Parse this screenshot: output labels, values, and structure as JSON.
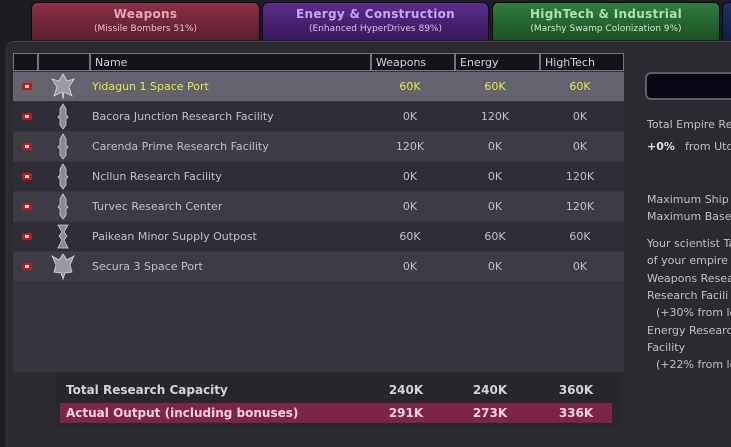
{
  "tabs": [
    {
      "title": "Weapons",
      "subtitle": "(Missile Bombers 51%)"
    },
    {
      "title": "Energy & Construction",
      "subtitle": "(Enhanced HyperDrives 89%)"
    },
    {
      "title": "HighTech & Industrial",
      "subtitle": "(Marshy Swamp Colonization 9%)"
    }
  ],
  "table": {
    "headers": {
      "name": "Name",
      "weapons": "Weapons",
      "energy": "Energy",
      "hightech": "HighTech"
    },
    "rows": [
      {
        "name": "Yidagun 1 Space Port",
        "weapons": "60K",
        "energy": "60K",
        "hightech": "60K",
        "icon": "space-port-icon"
      },
      {
        "name": "Bacora Junction Research Facility",
        "weapons": "0K",
        "energy": "120K",
        "hightech": "0K",
        "icon": "research-facility-icon"
      },
      {
        "name": "Carenda Prime Research Facility",
        "weapons": "120K",
        "energy": "0K",
        "hightech": "0K",
        "icon": "research-facility-icon"
      },
      {
        "name": "Ncllun Research Facility",
        "weapons": "0K",
        "energy": "0K",
        "hightech": "120K",
        "icon": "research-facility-icon"
      },
      {
        "name": "Turvec Research Center",
        "weapons": "0K",
        "energy": "0K",
        "hightech": "120K",
        "icon": "research-facility-icon"
      },
      {
        "name": "Paikean Minor Supply Outpost",
        "weapons": "60K",
        "energy": "60K",
        "hightech": "60K",
        "icon": "supply-outpost-icon"
      },
      {
        "name": "Secura 3 Space Port",
        "weapons": "0K",
        "energy": "0K",
        "hightech": "0K",
        "icon": "space-port-icon"
      }
    ]
  },
  "totals": {
    "capacity": {
      "label": "Total Research Capacity",
      "weapons": "240K",
      "energy": "240K",
      "hightech": "360K"
    },
    "output": {
      "label": "Actual Output (including bonuses)",
      "weapons": "291K",
      "energy": "273K",
      "hightech": "336K"
    }
  },
  "side": {
    "line1": "Total Empire Re",
    "pct": "+0%",
    "from": "from Uto",
    "max_ship": "Maximum Ship",
    "max_base": "Maximum Base",
    "l1": "Your scientist Ta",
    "l2": "of your empire",
    "l3": "Weapons Resea",
    "l4": "Research Facili",
    "l5": "(+30% from lo",
    "l6": "Energy Researc",
    "l7": "Facility",
    "l8": "(+22% from lo"
  },
  "colors": {
    "selected_text": "#efe74c",
    "output_bar": "#7c2547",
    "flag": "#b01e22"
  }
}
